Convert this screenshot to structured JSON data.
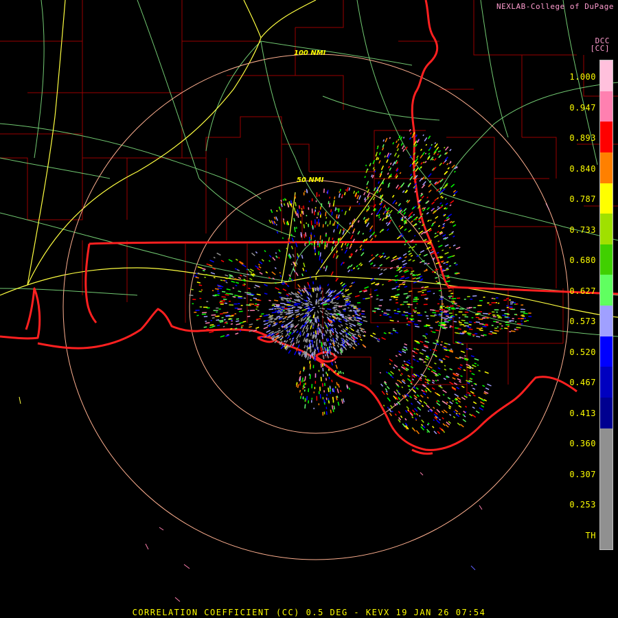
{
  "header": {
    "credit": "NEXLAB-College of DuPage",
    "product_code": "DCC",
    "unit": "[CC]"
  },
  "footer": {
    "caption": "CORRELATION COEFFICIENT (CC) 0.5 DEG - KEVX 19 JAN 26 07:54"
  },
  "range_rings": [
    "50 NMI",
    "100 NMI"
  ],
  "color_scale": {
    "labels": [
      "1.000",
      "0.947",
      "0.893",
      "0.840",
      "0.787",
      "0.733",
      "0.680",
      "0.627",
      "0.573",
      "0.520",
      "0.467",
      "0.413",
      "0.360",
      "0.307",
      "0.253",
      "TH"
    ],
    "colors": [
      "#ffc0dc",
      "#ff80b0",
      "#ff0000",
      "#ff8000",
      "#ffff00",
      "#a0e000",
      "#40d000",
      "#60ff60",
      "#a0a0ff",
      "#0000ff",
      "#0000c0",
      "#000090",
      "#909090",
      "#909090",
      "#909090",
      "#909090"
    ]
  },
  "colors": {
    "state_borders": "#ff2020",
    "county_lines": "#9a0000",
    "highways": "#ffff40",
    "roads": "#80ff80",
    "range_ring": "#ffb090",
    "scale_text": "#ffff00",
    "header_text": "#ff9ccf"
  }
}
